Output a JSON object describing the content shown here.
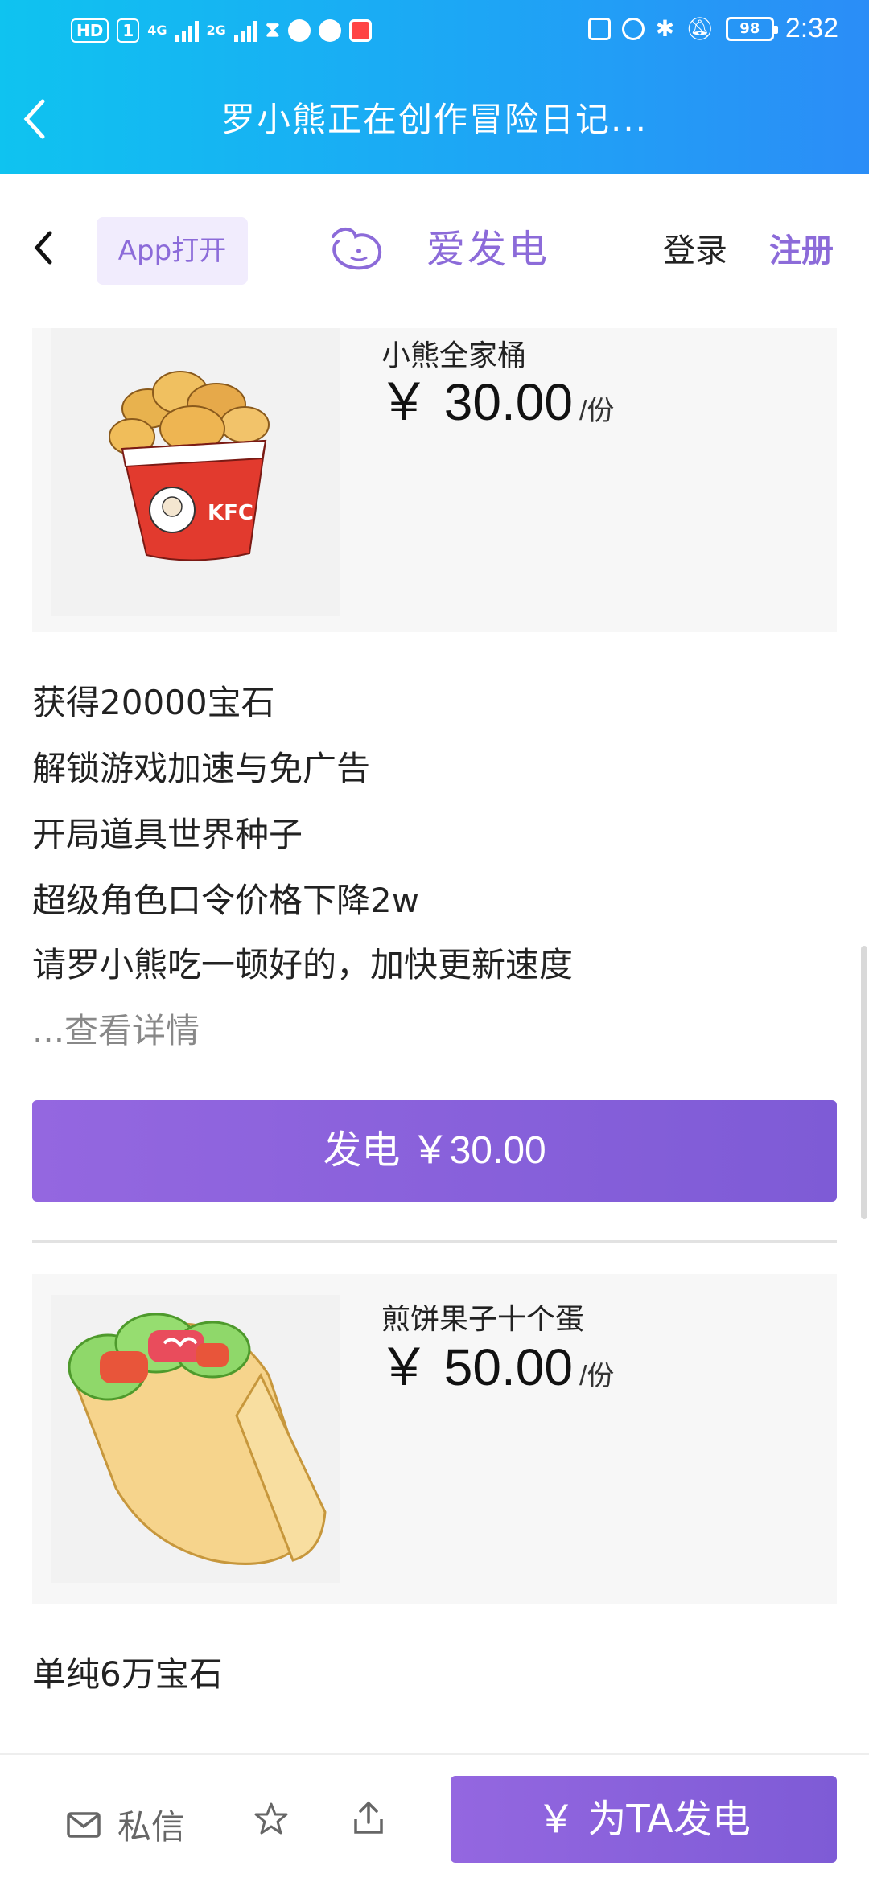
{
  "status_bar": {
    "left_badges": [
      "HD",
      "1"
    ],
    "signal_labels": [
      "4G",
      "2G"
    ],
    "battery": "98",
    "time": "2:32"
  },
  "app_header": {
    "title": "罗小熊正在创作冒险日记..."
  },
  "site_nav": {
    "open_in_app": "App打开",
    "logo_text": "爱发电",
    "login": "登录",
    "register": "注册",
    "accent_color": "#8c6bd9"
  },
  "tiers": [
    {
      "name": "小熊全家桶",
      "price": "￥ 30.00",
      "unit": "/份",
      "image_icon": "fried-chicken-bucket-illustration",
      "description": [
        "获得20000宝石",
        "解锁游戏加速与免广告",
        "开局道具世界种子",
        "超级角色口令价格下降2w",
        "请罗小熊吃一顿好的，加快更新速度"
      ],
      "more": "...查看详情",
      "button": "发电 ￥30.00"
    },
    {
      "name": "煎饼果子十个蛋",
      "price": "￥ 50.00",
      "unit": "/份",
      "image_icon": "jianbing-wrap-illustration",
      "description": [
        "单纯6万宝石"
      ]
    }
  ],
  "bottom_bar": {
    "message_label": "私信",
    "support_button": "￥  为TA发电"
  }
}
